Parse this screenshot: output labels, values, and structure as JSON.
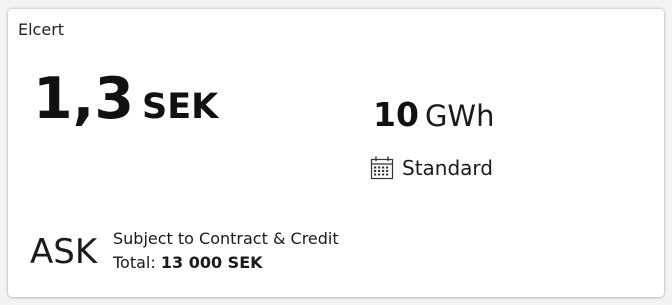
{
  "card": {
    "title": "Elcert",
    "price": {
      "value": "1,3",
      "currency": "SEK"
    },
    "volume": {
      "value": "10",
      "unit": "GWh"
    },
    "product": {
      "icon": "calendar-icon",
      "label": "Standard"
    },
    "side": "ASK",
    "terms": "Subject to Contract & Credit",
    "total": {
      "label": "Total:",
      "value": "13 000 SEK"
    }
  },
  "colors": {
    "background": "#f3f3f3",
    "card": "#ffffff",
    "text": "#111111"
  }
}
